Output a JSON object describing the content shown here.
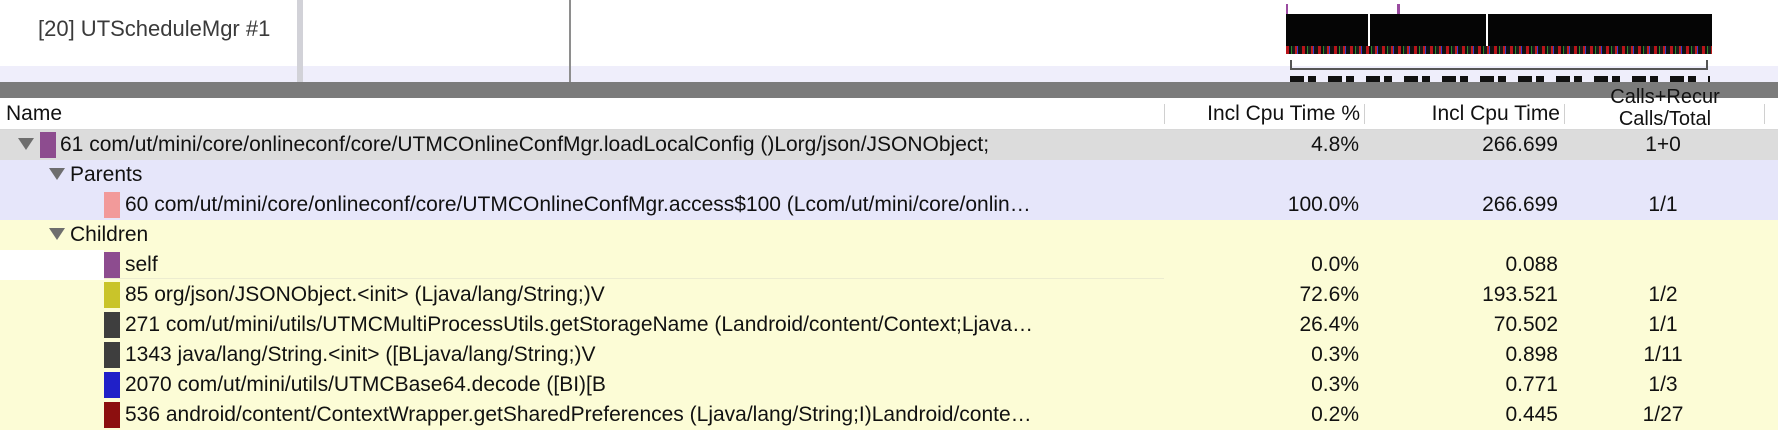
{
  "timeline": {
    "thread_label": "[20] UTScheduleMgr #1"
  },
  "table": {
    "columns": {
      "name": "Name",
      "incl_cpu_pct": "Incl Cpu Time %",
      "incl_cpu_time": "Incl Cpu Time",
      "calls_recur": "Calls+Recur",
      "calls_total": "Calls/Total"
    },
    "selected": {
      "label": "61 com/ut/mini/core/onlineconf/core/UTMCOnlineConfMgr.loadLocalConfig ()Lorg/json/JSONObject;",
      "pct": "4.8%",
      "time": "266.699",
      "calls": "1+0",
      "color": "#8d4c8f"
    },
    "parents_label": "Parents",
    "parents": [
      {
        "label": "60 com/ut/mini/core/onlineconf/core/UTMCOnlineConfMgr.access$100 (Lcom/ut/mini/core/onlin…",
        "pct": "100.0%",
        "time": "266.699",
        "calls": "1/1",
        "color": "#f29a9a"
      }
    ],
    "children_label": "Children",
    "children": [
      {
        "label": "self",
        "pct": "0.0%",
        "time": "0.088",
        "calls": "",
        "color": "#8d4c8f"
      },
      {
        "label": "85 org/json/JSONObject.<init> (Ljava/lang/String;)V",
        "pct": "72.6%",
        "time": "193.521",
        "calls": "1/2",
        "color": "#c9c42a"
      },
      {
        "label": "271 com/ut/mini/utils/UTMCMultiProcessUtils.getStorageName (Landroid/content/Context;Ljava…",
        "pct": "26.4%",
        "time": "70.502",
        "calls": "1/1",
        "color": "#3e3e3e"
      },
      {
        "label": "1343 java/lang/String.<init> ([BLjava/lang/String;)V",
        "pct": "0.3%",
        "time": "0.898",
        "calls": "1/11",
        "color": "#3e3e3e"
      },
      {
        "label": "2070 com/ut/mini/utils/UTMCBase64.decode ([BI)[B",
        "pct": "0.3%",
        "time": "0.771",
        "calls": "1/3",
        "color": "#2020c8"
      },
      {
        "label": "536 android/content/ContextWrapper.getSharedPreferences (Ljava/lang/String;I)Landroid/conte…",
        "pct": "0.2%",
        "time": "0.445",
        "calls": "1/27",
        "color": "#8c0f0f"
      }
    ]
  }
}
